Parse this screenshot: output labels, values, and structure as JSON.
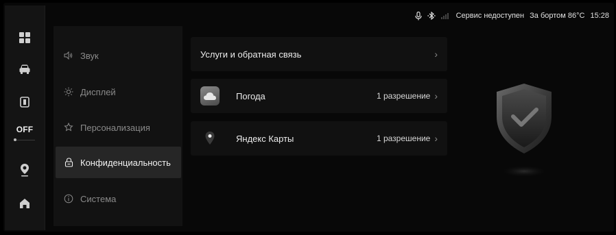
{
  "status_bar": {
    "mic_icon": "microphone-icon",
    "bluetooth_icon": "bluetooth-icon",
    "signal_icon": "signal-icon",
    "service_text": "Сервис недоступен",
    "outside_temp": "За бортом 86°C",
    "time": "15:28"
  },
  "rail": {
    "items": [
      {
        "icon": "apps-grid-icon"
      },
      {
        "icon": "car-icon"
      },
      {
        "icon": "phone-icon"
      },
      {
        "label": "OFF"
      },
      {
        "icon": "navigation-pin-icon"
      },
      {
        "icon": "home-icon"
      }
    ]
  },
  "menu": {
    "items": [
      {
        "label": "Звук",
        "icon": "sound-icon"
      },
      {
        "label": "Дисплей",
        "icon": "brightness-icon"
      },
      {
        "label": "Персонализация",
        "icon": "personalization-icon"
      },
      {
        "label": "Конфиденциальность",
        "icon": "privacy-lock-icon",
        "active": true
      },
      {
        "label": "Система",
        "icon": "system-info-icon"
      }
    ]
  },
  "content": {
    "services": {
      "title": "Услуги и обратная связь"
    },
    "apps": [
      {
        "name": "Погода",
        "permissions": "1 разрешение",
        "icon": "weather-cloud-icon"
      },
      {
        "name": "Яндекс Карты",
        "permissions": "1 разрешение",
        "icon": "yandex-maps-icon"
      }
    ]
  },
  "colors": {
    "background": "#080808",
    "panel": "#121212",
    "active_item": "#262626",
    "text_primary": "#ececec",
    "text_secondary": "#8a8a8a"
  }
}
